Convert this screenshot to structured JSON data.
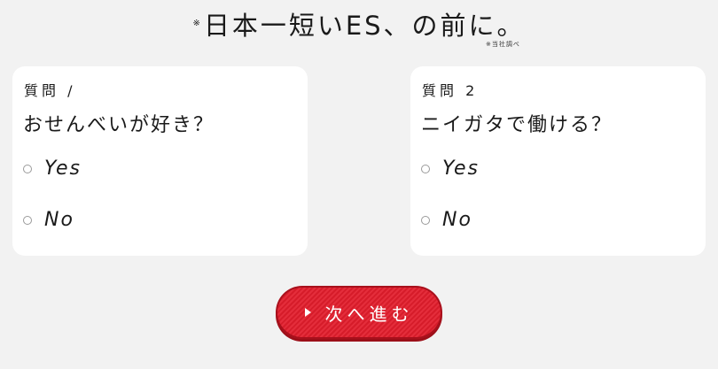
{
  "header": {
    "mark": "※",
    "title": "日本一短いES、の前に。",
    "note": "※当社調べ"
  },
  "questions": [
    {
      "label": "質問 /",
      "text": "おせんべいが好き？",
      "options": [
        {
          "label": "Yes"
        },
        {
          "label": "No"
        }
      ]
    },
    {
      "label": "質問 2",
      "text": "ニイガタで働ける？",
      "options": [
        {
          "label": "Yes"
        },
        {
          "label": "No"
        }
      ]
    }
  ],
  "next_button": {
    "label": "次へ進む",
    "icon": "play-triangle-icon",
    "color": "#e21d2c"
  }
}
